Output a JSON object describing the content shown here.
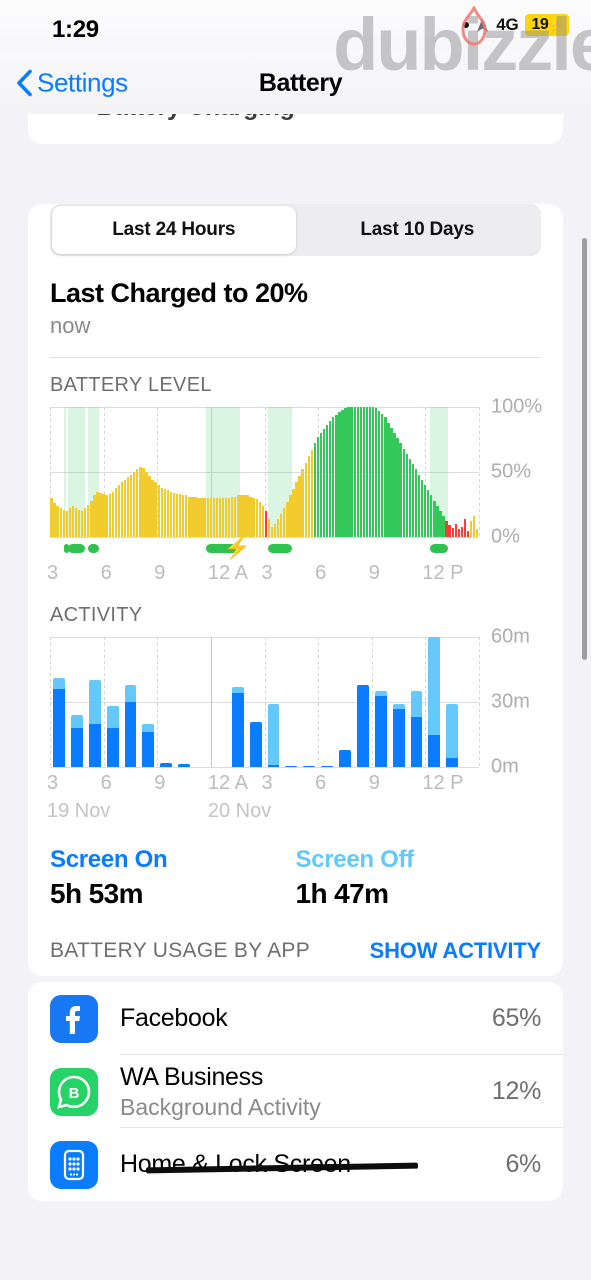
{
  "status_bar": {
    "time": "1:29",
    "network": "4G",
    "battery_percent": "19",
    "charging_bolt": "⚡",
    "battery_color": "#FFD60A"
  },
  "watermark": {
    "text": "dubizzle"
  },
  "nav": {
    "back_label": "Settings",
    "title": "Battery"
  },
  "segmented": {
    "options": [
      "Last 24 Hours",
      "Last 10 Days"
    ],
    "selected": "Last 24 Hours"
  },
  "last_charged": {
    "title": "Last Charged to 20%",
    "subtitle": "now"
  },
  "sections": {
    "battery_level_heading": "BATTERY LEVEL",
    "activity_heading": "ACTIVITY",
    "usage_heading": "BATTERY USAGE BY APP",
    "usage_action": "SHOW ACTIVITY"
  },
  "screen_stats": {
    "on_label": "Screen On",
    "on_value": "5h 53m",
    "off_label": "Screen Off",
    "off_value": "1h 47m"
  },
  "apps": [
    {
      "name": "Facebook",
      "subtitle": "",
      "percent": "65%",
      "icon": "facebook-icon",
      "icon_color": "#1877F2",
      "struck": false
    },
    {
      "name": "WA Business",
      "subtitle": "Background Activity",
      "percent": "12%",
      "icon": "whatsapp-business-icon",
      "icon_color": "#25D366",
      "struck": false
    },
    {
      "name": "Home & Lock Screen",
      "subtitle": "",
      "percent": "6%",
      "icon": "home-lock-screen-icon",
      "icon_color": "#0A7CFF",
      "struck": true
    }
  ],
  "chart_data": [
    {
      "type": "bar",
      "title": "BATTERY LEVEL",
      "ylabel": "",
      "xlabel": "",
      "ylim": [
        0,
        100
      ],
      "yticks": [
        "0%",
        "50%",
        "100%"
      ],
      "xticks": [
        "3",
        "6",
        "9",
        "12 A",
        "3",
        "6",
        "9",
        "12 P"
      ],
      "grid": true,
      "legend": "none",
      "colors": {
        "low_power": "#F2CC2F",
        "normal": "#34C759",
        "critical": "#FF3B30"
      },
      "values": [
        30,
        26,
        24,
        22,
        21,
        20,
        22,
        24,
        22,
        21,
        20,
        22,
        25,
        28,
        32,
        35,
        34,
        33,
        32,
        33,
        35,
        38,
        40,
        42,
        44,
        46,
        48,
        50,
        52,
        54,
        53,
        50,
        47,
        44,
        42,
        40,
        38,
        37,
        36,
        35,
        34,
        33,
        33,
        32,
        32,
        31,
        31,
        31,
        30,
        30,
        30,
        30,
        30,
        30,
        30,
        30,
        30,
        30,
        30,
        31,
        31,
        32,
        32,
        32,
        32,
        31,
        30,
        29,
        27,
        24,
        20,
        14,
        8,
        10,
        14,
        18,
        22,
        27,
        32,
        37,
        42,
        47,
        52,
        57,
        62,
        67,
        72,
        77,
        80,
        83,
        86,
        89,
        92,
        94,
        96,
        98,
        99,
        100,
        100,
        100,
        100,
        100,
        100,
        100,
        100,
        100,
        99,
        97,
        95,
        92,
        88,
        84,
        80,
        76,
        72,
        68,
        64,
        60,
        56,
        52,
        48,
        44,
        40,
        36,
        32,
        28,
        24,
        20,
        16,
        12,
        9,
        7,
        10,
        6,
        8,
        14,
        5,
        12,
        16,
        6
      ],
      "bar_states": [
        "low",
        "low",
        "low",
        "low",
        "low",
        "low",
        "low",
        "low",
        "low",
        "low",
        "low",
        "low",
        "low",
        "low",
        "low",
        "low",
        "low",
        "low",
        "low",
        "low",
        "low",
        "low",
        "low",
        "low",
        "low",
        "low",
        "low",
        "low",
        "low",
        "low",
        "low",
        "low",
        "low",
        "low",
        "low",
        "low",
        "low",
        "low",
        "low",
        "low",
        "low",
        "low",
        "low",
        "low",
        "low",
        "low",
        "low",
        "low",
        "low",
        "low",
        "low",
        "low",
        "low",
        "low",
        "low",
        "low",
        "low",
        "low",
        "low",
        "low",
        "low",
        "low",
        "low",
        "low",
        "low",
        "low",
        "low",
        "low",
        "low",
        "low",
        "crit",
        "low",
        "low",
        "low",
        "low",
        "low",
        "low",
        "low",
        "low",
        "low",
        "low",
        "low",
        "low",
        "low",
        "low",
        "low",
        "normal",
        "normal",
        "normal",
        "normal",
        "normal",
        "normal",
        "normal",
        "normal",
        "normal",
        "normal",
        "normal",
        "normal",
        "normal",
        "normal",
        "normal",
        "normal",
        "normal",
        "normal",
        "normal",
        "normal",
        "normal",
        "normal",
        "normal",
        "normal",
        "normal",
        "normal",
        "normal",
        "normal",
        "normal",
        "normal",
        "normal",
        "normal",
        "normal",
        "normal",
        "normal",
        "normal",
        "normal",
        "normal",
        "normal",
        "normal",
        "normal",
        "normal",
        "normal",
        "crit",
        "crit",
        "crit",
        "crit",
        "crit",
        "crit",
        "crit",
        "crit"
      ],
      "charging_windows": [
        {
          "start": 4.5,
          "end": 5.2
        },
        {
          "start": 6.0,
          "end": 11.5
        },
        {
          "start": 12.5,
          "end": 16.0
        },
        {
          "start": 51.0,
          "end": 62.0
        },
        {
          "start": 71.0,
          "end": 79.0
        },
        {
          "start": 124.0,
          "end": 130.0
        }
      ]
    },
    {
      "type": "bar",
      "title": "ACTIVITY",
      "ylabel": "",
      "xlabel": "",
      "ylim": [
        0,
        60
      ],
      "yticks": [
        "0m",
        "30m",
        "60m"
      ],
      "xticks": [
        "3",
        "6",
        "9",
        "12 A",
        "3",
        "6",
        "9",
        "12 P"
      ],
      "date_labels": [
        "19 Nov",
        "20 Nov"
      ],
      "grid": true,
      "stacked": true,
      "colors": {
        "screen_on": "#0A7CFF",
        "screen_off": "#64C8FA"
      },
      "series": [
        {
          "name": "Screen On",
          "values": [
            36,
            18,
            20,
            18,
            30,
            16,
            2,
            1.5,
            0,
            0,
            34,
            21,
            1,
            0.6,
            0.6,
            0.6,
            8,
            38,
            33,
            27,
            23,
            15,
            4,
            0
          ]
        },
        {
          "name": "Screen Off",
          "values": [
            5,
            6,
            20,
            10,
            8,
            4,
            0,
            0,
            0,
            0,
            3,
            0,
            28,
            0,
            0,
            0,
            0,
            0,
            2,
            2,
            12,
            45,
            25,
            0
          ]
        }
      ]
    }
  ]
}
